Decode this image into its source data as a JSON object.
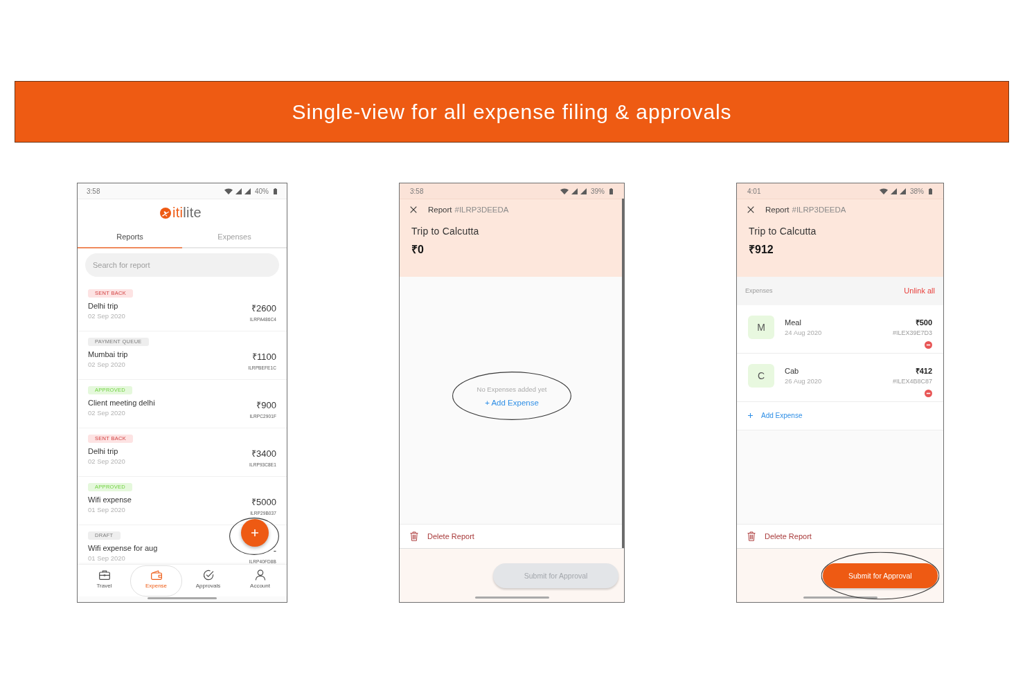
{
  "banner": {
    "title": "Single-view for all expense filing & approvals"
  },
  "screens": [
    {
      "kind": "report_list",
      "status_bar": {
        "time": "3:58",
        "battery": "40%"
      },
      "logo": {
        "accent": "iti",
        "text": "lite"
      },
      "tabs": [
        {
          "label": "Reports",
          "selected": true
        },
        {
          "label": "Expenses",
          "selected": false
        }
      ],
      "search": {
        "placeholder": "Search for report"
      },
      "reports": [
        {
          "status": {
            "label": "SENT BACK",
            "color": "#fde3e3"
          },
          "name": "Delhi trip",
          "date": "02 Sep 2020",
          "amount": "₹2600",
          "id": "ILRPA486C4"
        },
        {
          "status": {
            "label": "PAYMENT QUEUE",
            "color": "#eeeeee"
          },
          "name": "Mumbai trip",
          "date": "02 Sep 2020",
          "amount": "₹1100",
          "id": "ILRPBEFE1C"
        },
        {
          "status": {
            "label": "APPROVED",
            "color": "#e5f8dc"
          },
          "name": "Client meeting delhi",
          "date": "02 Sep 2020",
          "amount": "₹900",
          "id": "ILRPC2901F"
        },
        {
          "status": {
            "label": "SENT BACK",
            "color": "#fde3e3"
          },
          "name": "Delhi trip",
          "date": "02 Sep 2020",
          "amount": "₹3400",
          "id": "ILRP93C8E1"
        },
        {
          "status": {
            "label": "APPROVED",
            "color": "#e5f8dc"
          },
          "name": "Wifi expense",
          "date": "01 Sep 2020",
          "amount": "₹5000",
          "id": "ILRP29B037"
        },
        {
          "status": {
            "label": "DRAFT",
            "color": "#eeeeee"
          },
          "name": "Wifi expense for aug",
          "date": "01 Sep 2020",
          "amount": "-",
          "id": "ILRP40FD8B"
        }
      ],
      "fab": {
        "highlighted": true
      },
      "bottom_nav": [
        {
          "label": "Travel",
          "selected": false
        },
        {
          "label": "Expense",
          "selected": true
        },
        {
          "label": "Approvals",
          "selected": false
        },
        {
          "label": "Account",
          "selected": false
        }
      ]
    },
    {
      "kind": "report_detail",
      "status_bar": {
        "time": "3:58",
        "battery": "39%"
      },
      "scrollbar": true,
      "header": {
        "label": "Report",
        "report_id": "#ILRP3DEEDA",
        "title": "Trip to Calcutta",
        "total": "₹0"
      },
      "empty_state": {
        "message": "No Expenses added yet",
        "action": "+ Add Expense",
        "highlighted": true
      },
      "delete_action": "Delete Report",
      "submit": {
        "label": "Submit for Approval",
        "disabled": true
      }
    },
    {
      "kind": "report_detail",
      "status_bar": {
        "time": "4:01",
        "battery": "38%"
      },
      "header": {
        "label": "Report",
        "report_id": "#ILRP3DEEDA",
        "title": "Trip to Calcutta",
        "total": "₹912"
      },
      "expenses_section": {
        "label": "Expenses",
        "action": "Unlink all"
      },
      "expenses": [
        {
          "initial": "M",
          "name": "Meal",
          "date": "24 Aug 2020",
          "amount": "₹500",
          "id": "#ILEX39E7D3"
        },
        {
          "initial": "C",
          "name": "Cab",
          "date": "26 Aug 2020",
          "amount": "₹412",
          "id": "#ILEX4B8C87"
        }
      ],
      "add_expense": "Add Expense",
      "delete_action": "Delete Report",
      "submit": {
        "label": "Submit for Approval",
        "disabled": false,
        "highlighted": true
      }
    }
  ]
}
